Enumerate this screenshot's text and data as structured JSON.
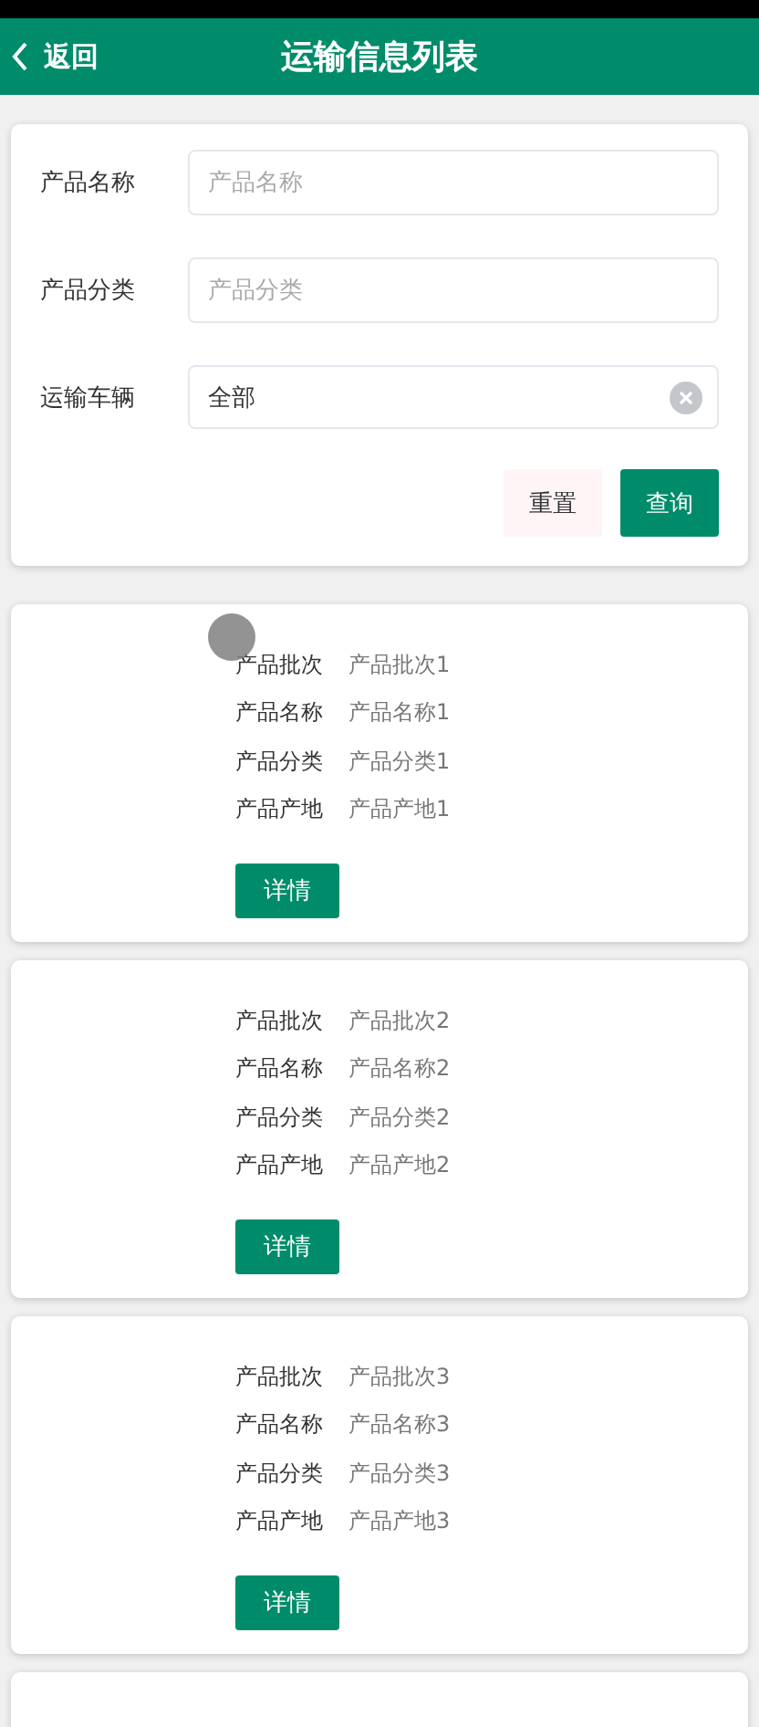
{
  "header": {
    "back": "返回",
    "title": "运输信息列表"
  },
  "filters": [
    {
      "kind": "text",
      "label": "产品名称",
      "placeholder": "产品名称"
    },
    {
      "kind": "select",
      "label": "产品分类",
      "placeholder": "产品分类"
    },
    {
      "kind": "clearable",
      "label": "运输车辆",
      "value": "全部"
    }
  ],
  "buttons": {
    "reset": "重置",
    "search": "查询"
  },
  "records": [
    {
      "fields": [
        {
          "label": "产品批次",
          "value": "产品批次1"
        },
        {
          "label": "产品名称",
          "value": "产品名称1"
        },
        {
          "label": "产品分类",
          "value": "产品分类1"
        },
        {
          "label": "产品产地",
          "value": "产品产地1"
        }
      ],
      "action": "详情"
    },
    {
      "fields": [
        {
          "label": "产品批次",
          "value": "产品批次2"
        },
        {
          "label": "产品名称",
          "value": "产品名称2"
        },
        {
          "label": "产品分类",
          "value": "产品分类2"
        },
        {
          "label": "产品产地",
          "value": "产品产地2"
        }
      ],
      "action": "详情"
    },
    {
      "fields": [
        {
          "label": "产品批次",
          "value": "产品批次3"
        },
        {
          "label": "产品名称",
          "value": "产品名称3"
        },
        {
          "label": "产品分类",
          "value": "产品分类3"
        },
        {
          "label": "产品产地",
          "value": "产品产地3"
        }
      ],
      "action": "详情"
    }
  ]
}
